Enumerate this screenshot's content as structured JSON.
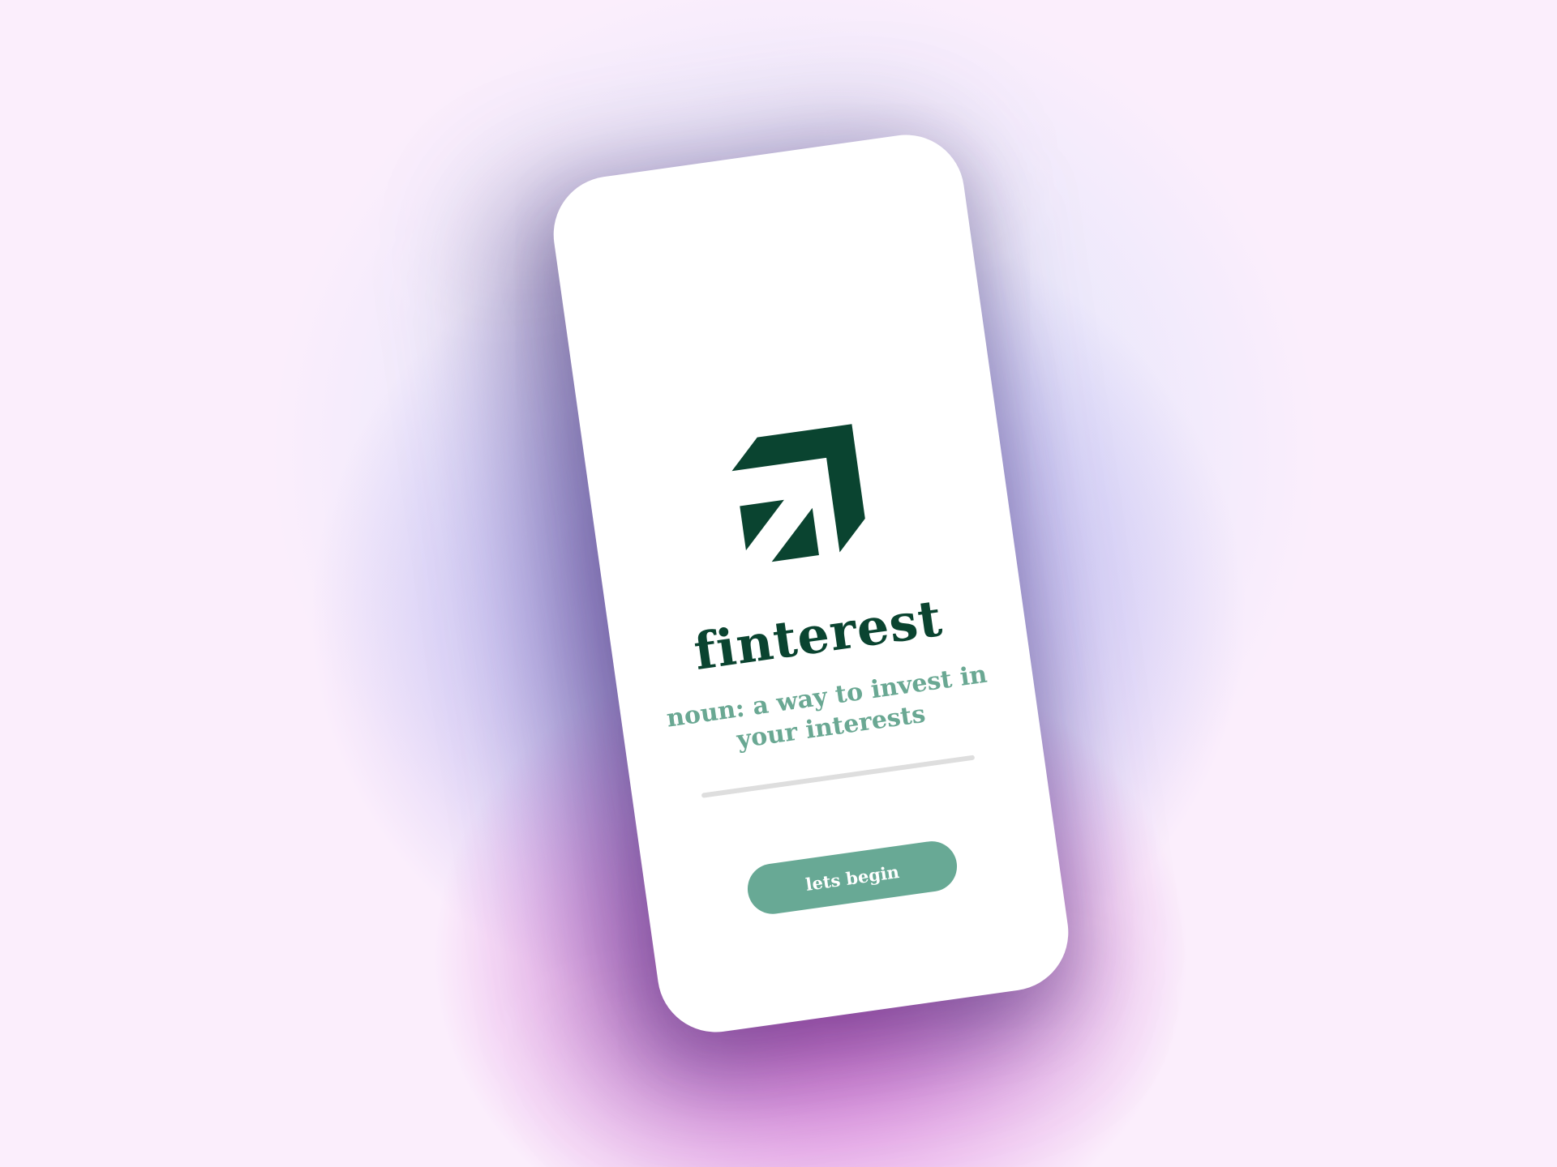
{
  "app": {
    "brand_name": "finterest",
    "tagline": "noun: a way to invest in your interests",
    "cta_label": "lets begin",
    "logo_icon": "upward-arrow-logo-icon"
  },
  "colors": {
    "brand_dark": "#0a4430",
    "brand_accent": "#68a995",
    "divider": "#dedede",
    "screen": "#ffffff"
  }
}
